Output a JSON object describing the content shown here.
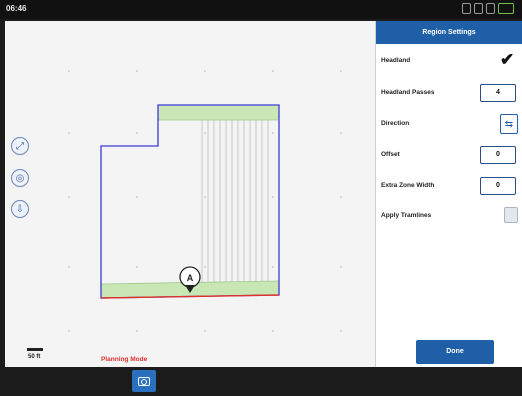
{
  "status_bar": {
    "time": "06:46"
  },
  "map": {
    "marker_label": "A",
    "scale_label": "50 ft",
    "mode_label": "Planning Mode",
    "controls": [
      {
        "icon": "expand-icon",
        "glyph": "⤢"
      },
      {
        "icon": "recenter-icon",
        "glyph": "◎"
      },
      {
        "icon": "layers-icon",
        "glyph": "⇩"
      }
    ]
  },
  "panel": {
    "title": "Region Settings",
    "headland_label": "Headland",
    "headland_checked": "✔",
    "headland_passes_label": "Headland Passes",
    "headland_passes_value": "4",
    "direction_label": "Direction",
    "direction_glyph": "⇆",
    "offset_label": "Offset",
    "offset_value": "0",
    "extra_zone_width_label": "Extra Zone Width",
    "extra_zone_width_value": "0",
    "apply_tramlines_label": "Apply Tramlines",
    "done_label": "Done"
  },
  "colors": {
    "accent": "#1e5fa8",
    "boundary": "#3b3bd6",
    "headland_fill": "#c9e7b4",
    "reference_line": "#e0322b",
    "planning_mode": "#e0322b"
  }
}
